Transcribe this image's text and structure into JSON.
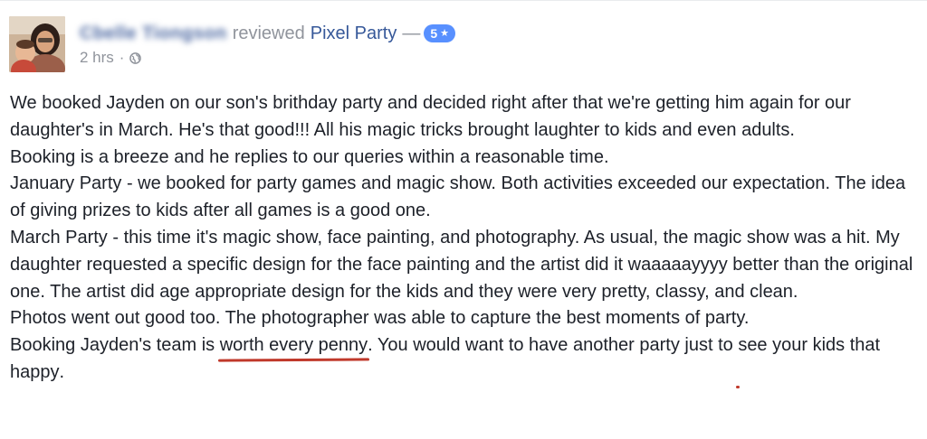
{
  "post": {
    "author_name": "Cbelle Tiongson",
    "action_text": "reviewed",
    "page_name": "Pixel Party",
    "dash": "—",
    "rating": "5",
    "rating_icon": "star-icon",
    "time": "2 hrs",
    "separator": "·",
    "audience_icon": "globe-icon",
    "colors": {
      "link": "#365899",
      "meta": "#90949c",
      "badge": "#5890ff",
      "underline": "#c0392b"
    }
  },
  "review": {
    "paragraphs": [
      "We booked Jayden on our son's brithday party and decided right after that we're getting him again for our daughter's in March. He's that good!!! All his magic tricks brought laughter to kids and even adults.",
      "Booking is a breeze and he replies to our queries within a reasonable time.",
      "January Party - we booked for party games and magic show. Both activities exceeded our expectation. The idea of giving prizes to kids after all games is a good one.",
      "March Party - this time it's magic show, face painting, and photography. As usual, the magic show was a hit. My daughter requested a specific design for the face painting and the artist did it waaaaayyyy better than the original one. The artist did age appropriate design for the kids and they were very pretty, classy, and clean.",
      "Photos went out good too. The photographer was able to capture the best moments of party."
    ],
    "last_paragraph": {
      "part1": "Booking Jayden's team is ",
      "highlight1": "worth every penny",
      "part2": ". You would want to have another party just to ",
      "highlight2": "see your kids that happy",
      "part3": "."
    }
  }
}
